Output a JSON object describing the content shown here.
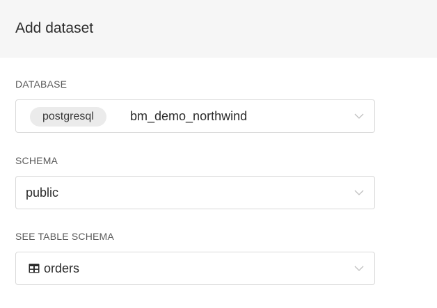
{
  "header": {
    "title": "Add dataset"
  },
  "database": {
    "label": "DATABASE",
    "engine_badge": "postgresql",
    "value": "bm_demo_northwind"
  },
  "schema": {
    "label": "SCHEMA",
    "value": "public"
  },
  "table": {
    "label": "SEE TABLE SCHEMA",
    "value": "orders",
    "icon": "table-icon"
  },
  "icons": {
    "dropdown": "chevron-down-icon"
  },
  "colors": {
    "header_bg": "#f6f6f6",
    "border": "#d9d9d9",
    "badge_bg": "#ebebeb"
  }
}
